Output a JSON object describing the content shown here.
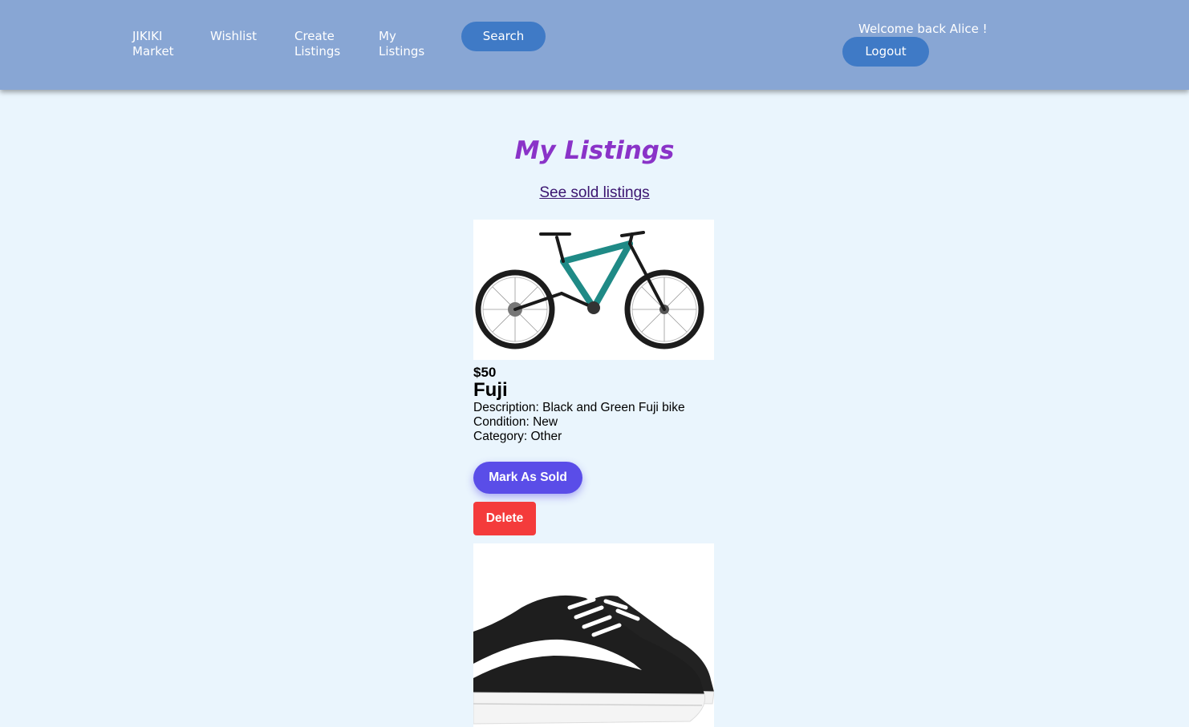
{
  "nav": {
    "brand": "JIKIKI\nMarket",
    "wishlist": "Wishlist",
    "create_listings": "Create\nListings",
    "my_listings": "My\nListings",
    "search": "Search",
    "welcome": "Welcome back Alice !",
    "logout": "Logout"
  },
  "page": {
    "title": "My Listings",
    "sold_link": "See sold listings"
  },
  "listings": [
    {
      "price": "$50",
      "title": "Fuji",
      "description": "Description: Black and Green Fuji bike",
      "condition": "Condition: New",
      "category": "Category: Other",
      "mark_sold": "Mark As Sold",
      "delete": "Delete"
    }
  ],
  "colors": {
    "navbar": "#88a6d4",
    "nav_button": "#3f7ac6",
    "background": "#eaf5fd",
    "title": "#8a33c8",
    "mark_sold": "#5a4de8",
    "delete": "#f43b3b"
  }
}
